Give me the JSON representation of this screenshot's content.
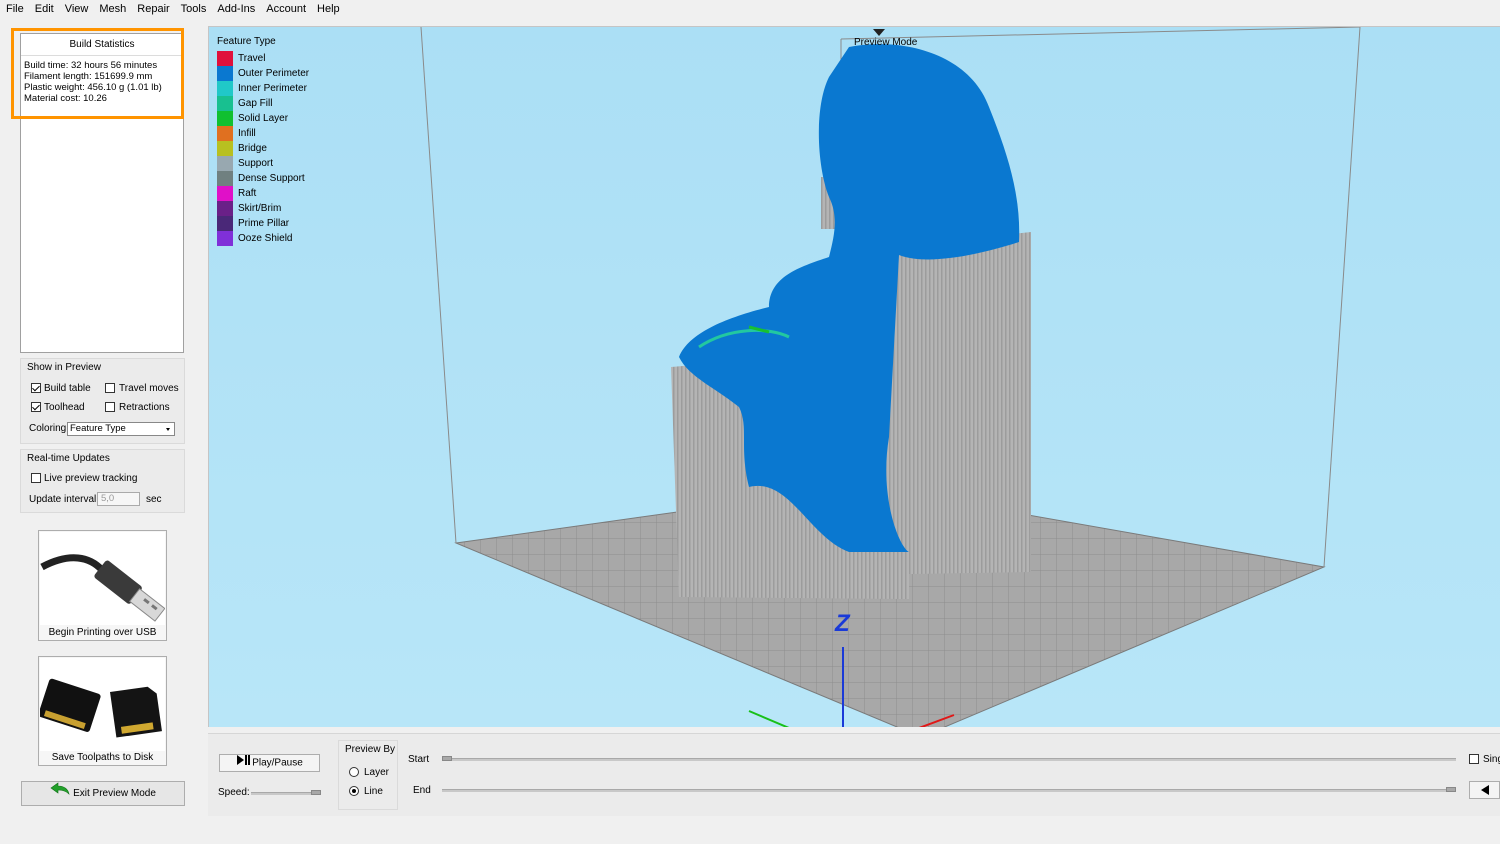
{
  "menu": [
    "File",
    "Edit",
    "View",
    "Mesh",
    "Repair",
    "Tools",
    "Add-Ins",
    "Account",
    "Help"
  ],
  "build_stats": {
    "title": "Build Statistics",
    "build_time": "Build time: 32 hours 56 minutes",
    "filament": "Filament length: 151699.9 mm",
    "weight": "Plastic weight: 456.10 g (1.01 lb)",
    "cost": "Material cost: 10.26"
  },
  "show_in_preview": {
    "title": "Show in Preview",
    "build_table": "Build table",
    "travel_moves": "Travel moves",
    "toolhead": "Toolhead",
    "retractions": "Retractions",
    "coloring_label": "Coloring",
    "coloring_value": "Feature Type"
  },
  "realtime": {
    "title": "Real-time Updates",
    "live_tracking": "Live preview tracking",
    "interval_label": "Update interval",
    "interval_value": "5,0",
    "interval_unit": "sec"
  },
  "buttons": {
    "usb": "Begin Printing over USB",
    "disk": "Save Toolpaths to Disk",
    "exit": "Exit Preview Mode",
    "play": "Play/Pause"
  },
  "viewport": {
    "mode_label": "Preview Mode",
    "axis_z": "Z"
  },
  "legend": {
    "title": "Feature Type",
    "items": [
      {
        "label": "Travel",
        "color": "#e0103c"
      },
      {
        "label": "Outer Perimeter",
        "color": "#0a78d0"
      },
      {
        "label": "Inner Perimeter",
        "color": "#20c8c8"
      },
      {
        "label": "Gap Fill",
        "color": "#18c090"
      },
      {
        "label": "Solid Layer",
        "color": "#10c030"
      },
      {
        "label": "Infill",
        "color": "#e07020"
      },
      {
        "label": "Bridge",
        "color": "#b8c020"
      },
      {
        "label": "Support",
        "color": "#98a8b0"
      },
      {
        "label": "Dense Support",
        "color": "#708080"
      },
      {
        "label": "Raft",
        "color": "#e010c8"
      },
      {
        "label": "Skirt/Brim",
        "color": "#6a2088"
      },
      {
        "label": "Prime Pillar",
        "color": "#4a2878"
      },
      {
        "label": "Ooze Shield",
        "color": "#8030d8"
      }
    ]
  },
  "bottom": {
    "speed_label": "Speed:",
    "preview_by_title": "Preview By",
    "layer": "Layer",
    "line": "Line",
    "start": "Start",
    "end": "End",
    "single": "Sing"
  }
}
